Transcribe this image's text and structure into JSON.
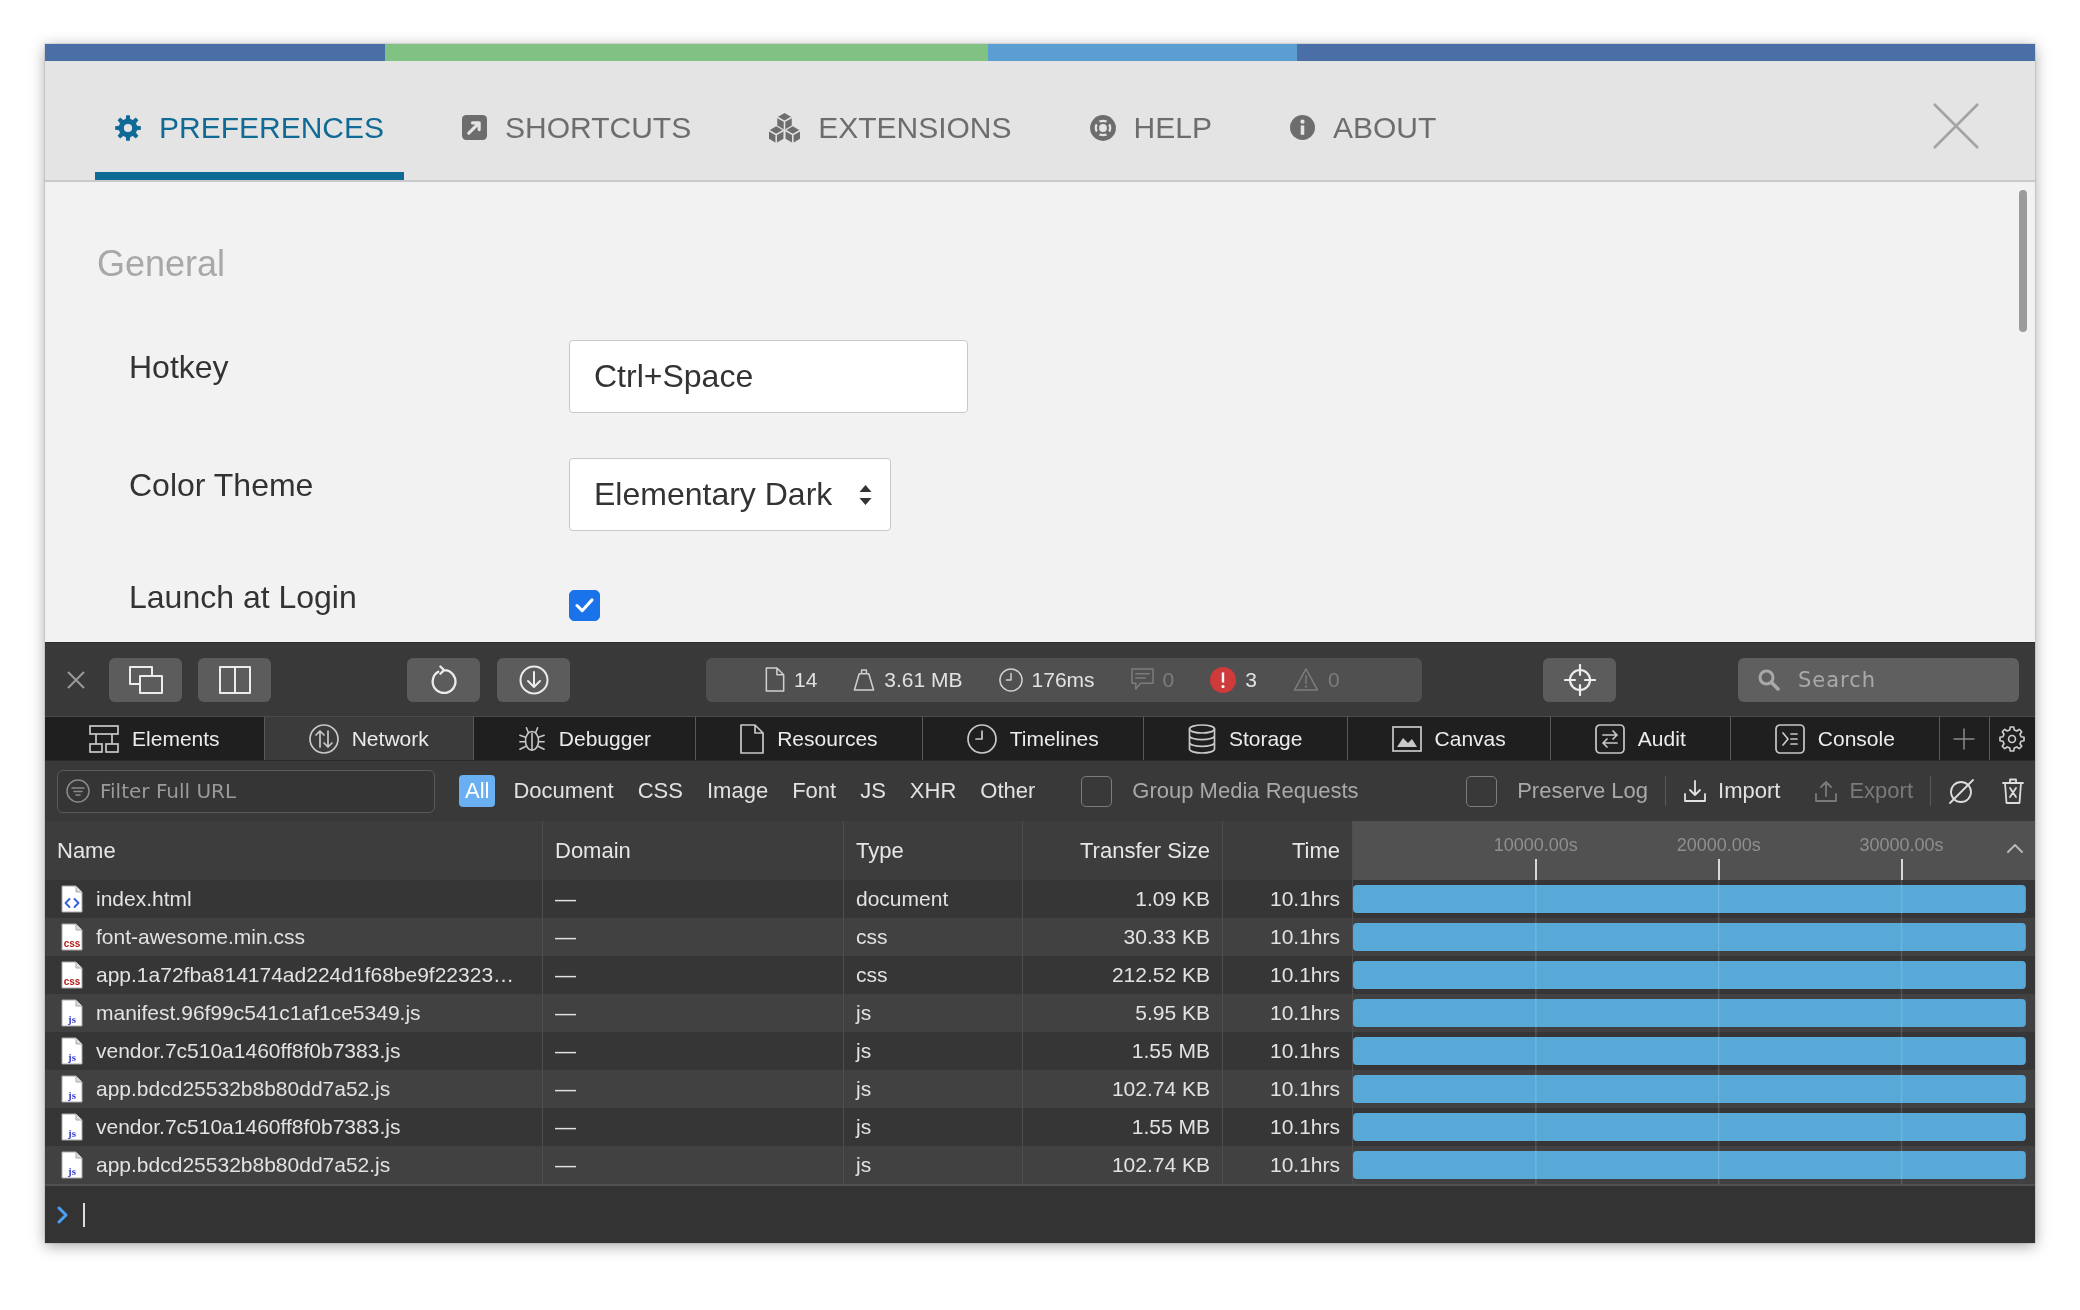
{
  "header": {
    "tabs": [
      {
        "label": "PREFERENCES",
        "selected": true
      },
      {
        "label": "SHORTCUTS",
        "selected": false
      },
      {
        "label": "EXTENSIONS",
        "selected": false
      },
      {
        "label": "HELP",
        "selected": false
      },
      {
        "label": "ABOUT",
        "selected": false
      }
    ]
  },
  "preferences": {
    "section_title": "General",
    "settings": [
      {
        "kind": "text",
        "label": "Hotkey",
        "value": "Ctrl+Space"
      },
      {
        "kind": "select",
        "label": "Color Theme",
        "value": "Elementary Dark"
      },
      {
        "kind": "checkbox",
        "label": "Launch at Login",
        "checked": true
      }
    ]
  },
  "devtools": {
    "toolbar": {
      "stats": [
        {
          "kind": "resources",
          "text": "14",
          "dimmed": false
        },
        {
          "kind": "size",
          "text": "3.61 MB",
          "dimmed": false
        },
        {
          "kind": "time",
          "text": "176ms",
          "dimmed": false
        },
        {
          "kind": "messages",
          "text": "0",
          "dimmed": true
        },
        {
          "kind": "errors",
          "text": "3",
          "dimmed": false
        },
        {
          "kind": "warnings",
          "text": "0",
          "dimmed": true
        }
      ],
      "search": {
        "placeholder": "Search"
      }
    },
    "tabs": [
      {
        "label": "Elements",
        "selected": false
      },
      {
        "label": "Network",
        "selected": true
      },
      {
        "label": "Debugger",
        "selected": false
      },
      {
        "label": "Resources",
        "selected": false
      },
      {
        "label": "Timelines",
        "selected": false
      },
      {
        "label": "Storage",
        "selected": false
      },
      {
        "label": "Canvas",
        "selected": false
      },
      {
        "label": "Audit",
        "selected": false
      },
      {
        "label": "Console",
        "selected": false
      }
    ],
    "filter_bar": {
      "filter": {
        "placeholder": "Filter Full URL"
      },
      "types": [
        {
          "label": "All",
          "selected": true
        },
        {
          "label": "Document",
          "selected": false
        },
        {
          "label": "CSS",
          "selected": false
        },
        {
          "label": "Image",
          "selected": false
        },
        {
          "label": "Font",
          "selected": false
        },
        {
          "label": "JS",
          "selected": false
        },
        {
          "label": "XHR",
          "selected": false
        },
        {
          "label": "Other",
          "selected": false
        }
      ],
      "group_media": {
        "label": "Group Media Requests",
        "checked": false
      },
      "preserve_log": {
        "label": "Preserve Log",
        "checked": false
      },
      "actions": [
        {
          "label": "Import",
          "disabled": false
        },
        {
          "label": "Export",
          "disabled": true
        }
      ]
    },
    "table": {
      "columns": [
        "Name",
        "Domain",
        "Type",
        "Transfer Size",
        "Time"
      ],
      "rows": [
        {
          "kind": "html",
          "name": "index.html",
          "domain": "—",
          "type": "document",
          "size": "1.09 KB",
          "time": "10.1hrs"
        },
        {
          "kind": "css",
          "icon_text": "css",
          "name": "font-awesome.min.css",
          "domain": "—",
          "type": "css",
          "size": "30.33 KB",
          "time": "10.1hrs"
        },
        {
          "kind": "css",
          "icon_text": "css",
          "name": "app.1a72fba814174ad224d1f68be9f22323…",
          "domain": "—",
          "type": "css",
          "size": "212.52 KB",
          "time": "10.1hrs"
        },
        {
          "kind": "js",
          "icon_text": "js",
          "name": "manifest.96f99c541c1af1ce5349.js",
          "domain": "—",
          "type": "js",
          "size": "5.95 KB",
          "time": "10.1hrs"
        },
        {
          "kind": "js",
          "icon_text": "js",
          "name": "vendor.7c510a1460ff8f0b7383.js",
          "domain": "—",
          "type": "js",
          "size": "1.55 MB",
          "time": "10.1hrs"
        },
        {
          "kind": "js",
          "icon_text": "js",
          "name": "app.bdcd25532b8b80dd7a52.js",
          "domain": "—",
          "type": "js",
          "size": "102.74 KB",
          "time": "10.1hrs"
        },
        {
          "kind": "js",
          "icon_text": "js",
          "name": "vendor.7c510a1460ff8f0b7383.js",
          "domain": "—",
          "type": "js",
          "size": "1.55 MB",
          "time": "10.1hrs"
        },
        {
          "kind": "js",
          "icon_text": "js",
          "name": "app.bdcd25532b8b80dd7a52.js",
          "domain": "—",
          "type": "js",
          "size": "102.74 KB",
          "time": "10.1hrs"
        }
      ],
      "timeline": {
        "chart_data": {
          "type": "bar",
          "orientation": "horizontal",
          "grid": true,
          "xlim": [
            0,
            37300
          ],
          "xticks": [
            {
              "value": 10000,
              "label": "10000.00s"
            },
            {
              "value": 20000,
              "label": "20000.00s"
            },
            {
              "value": 30000,
              "label": "30000.00s"
            }
          ],
          "values": [
            36800,
            36800,
            36800,
            36800,
            36800,
            36800,
            36800,
            36800
          ]
        }
      }
    }
  }
}
